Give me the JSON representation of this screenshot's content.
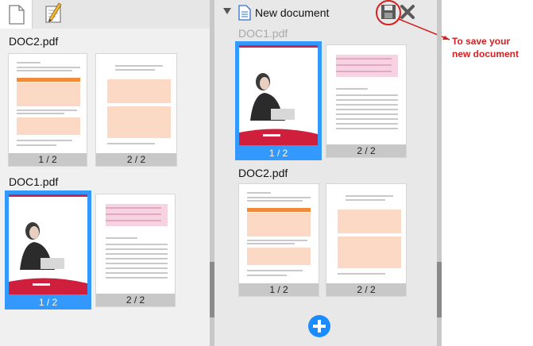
{
  "left": {
    "doc2_label": "DOC2.pdf",
    "doc1_label": "DOC1.pdf",
    "doc2_pages": [
      "1 / 2",
      "2 / 2"
    ],
    "doc1_pages": [
      "1 / 2",
      "2 / 2"
    ]
  },
  "right": {
    "title": "New document",
    "docs": [
      {
        "label": "DOC1.pdf",
        "pages": [
          "1 / 2",
          "2 / 2"
        ]
      },
      {
        "label": "DOC2.pdf",
        "pages": [
          "1 / 2",
          "2 / 2"
        ]
      }
    ]
  },
  "annotation": {
    "text": "To save your new document"
  },
  "icons": {
    "toolbar": [
      "page-icon",
      "edit-icon"
    ],
    "header": [
      "collapse-triangle-icon",
      "document-icon",
      "save-icon",
      "close-icon",
      "add-icon"
    ]
  },
  "colors": {
    "selection": "#3399ff",
    "annotation": "#d62020",
    "add_button": "#1a8cff"
  }
}
